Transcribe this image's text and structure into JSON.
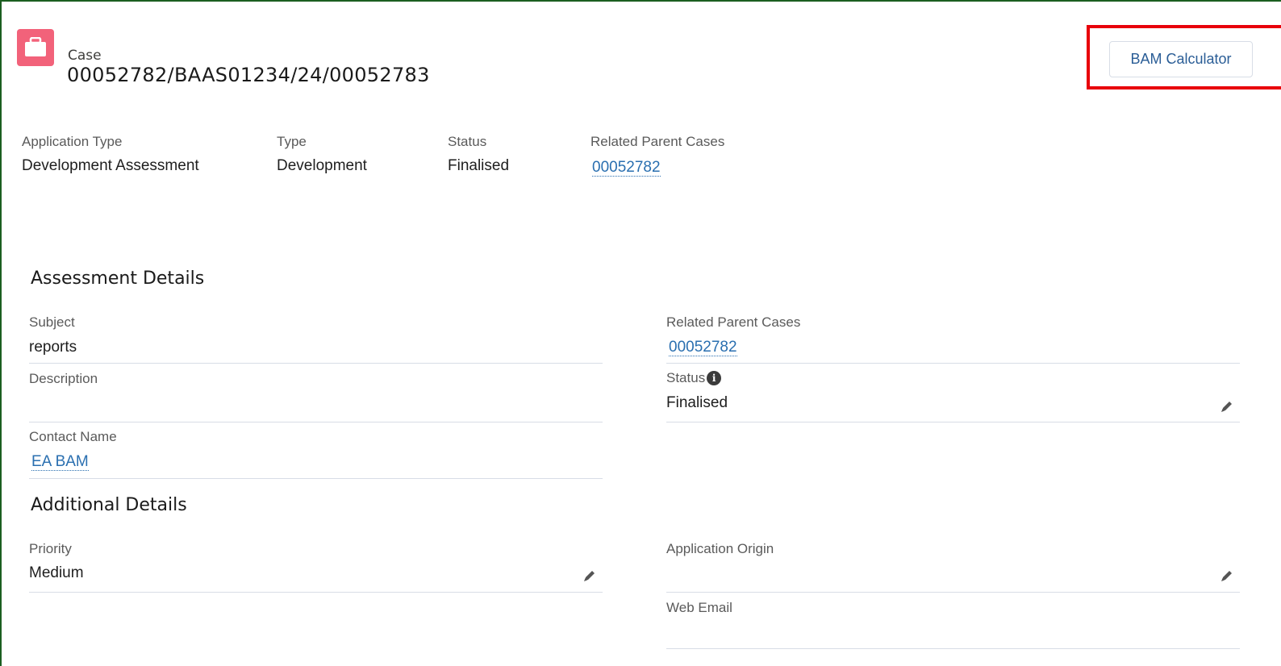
{
  "header": {
    "object_label": "Case",
    "case_number": "00052782/BAAS01234/24/00052783",
    "icon": "briefcase-icon",
    "action_button": "BAM Calculator"
  },
  "highlights": [
    {
      "label": "Application Type",
      "value": "Development Assessment"
    },
    {
      "label": "Type",
      "value": "Development"
    },
    {
      "label": "Status",
      "value": "Finalised"
    },
    {
      "label": "Related Parent Cases",
      "value": "00052782"
    }
  ],
  "assessment_details": {
    "title": "Assessment Details",
    "subject_label": "Subject",
    "subject_value": "reports",
    "related_label": "Related Parent Cases",
    "related_value": "00052782",
    "description_label": "Description",
    "description_value": "",
    "status_label": "Status",
    "status_value": "Finalised",
    "contact_label": "Contact Name",
    "contact_value": "EA BAM"
  },
  "additional_details": {
    "title": "Additional Details",
    "priority_label": "Priority",
    "priority_value": "Medium",
    "origin_label": "Application Origin",
    "origin_value": "",
    "web_email_label": "Web Email",
    "web_email_value": ""
  },
  "colors": {
    "icon_bg": "#f2627a",
    "highlight_border": "#e8000b",
    "link": "#2a6fb0"
  }
}
